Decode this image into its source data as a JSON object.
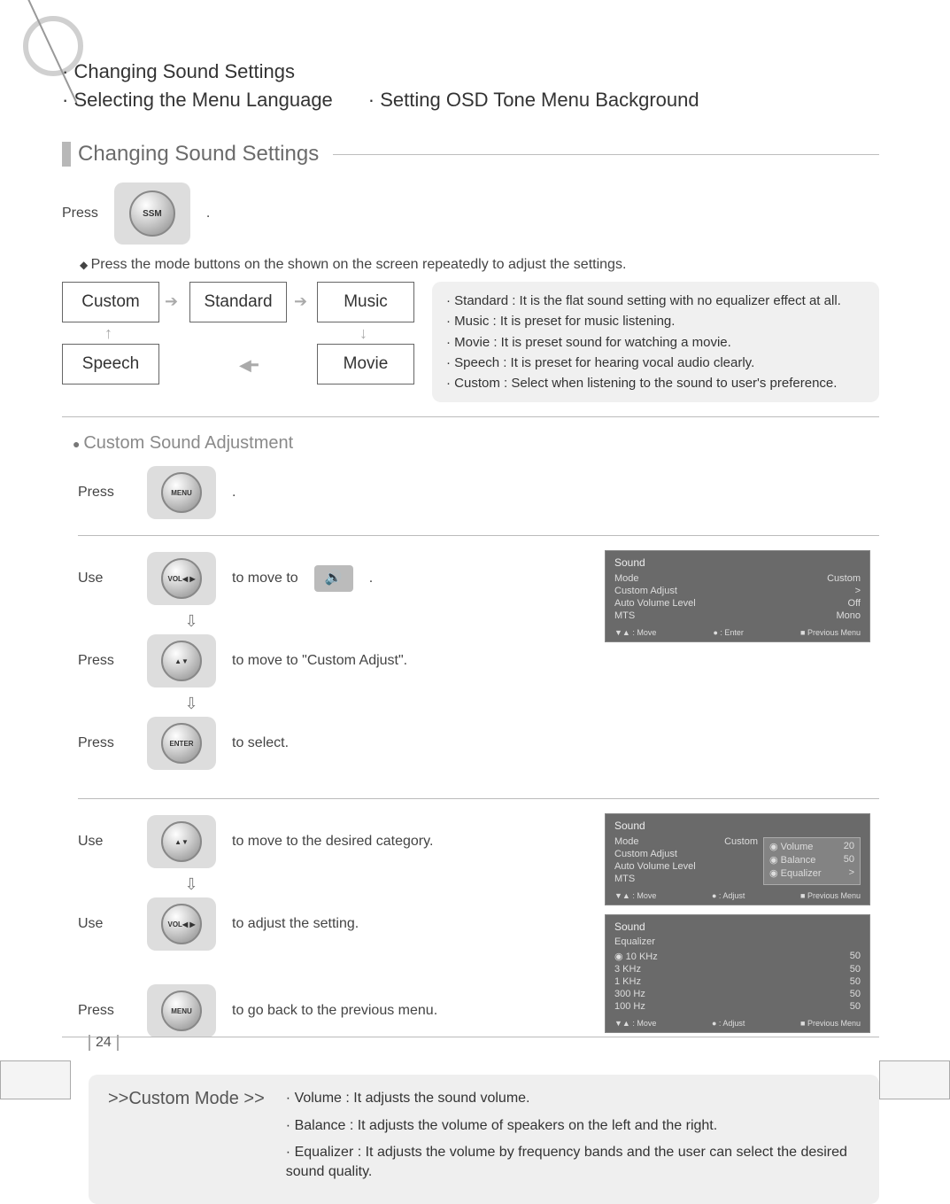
{
  "topics": {
    "a": "Changing Sound Settings",
    "b": "Selecting the Menu Language",
    "c": "Setting OSD Tone Menu Background"
  },
  "section_title": "Changing Sound Settings",
  "press_label": "Press",
  "use_label": "Use",
  "ssm_label": "SSM",
  "note_press_mode": "Press the mode buttons on the shown on the screen repeatedly to adjust the settings.",
  "modes": {
    "custom": "Custom",
    "standard": "Standard",
    "music": "Music",
    "speech": "Speech",
    "movie": "Movie"
  },
  "mode_desc": {
    "standard": "Standard : It is the flat sound setting with no equalizer effect at all.",
    "music": "Music : It is preset for music listening.",
    "movie": "Movie : It is preset sound for watching a movie.",
    "speech": "Speech : It is preset for hearing vocal audio clearly.",
    "custom": "Custom : Select when listening to the sound to user's preference."
  },
  "subsection_title": "Custom Sound Adjustment",
  "steps": {
    "s1_suffix": ".",
    "s2_prefix": "to move to",
    "s2_suffix": ".",
    "s3": "to move to \"Custom Adjust\".",
    "s4": "to select.",
    "s5": "to move to the desired category.",
    "s6": "to adjust the setting.",
    "s7": "to go back to the previous menu."
  },
  "btns": {
    "menu": "MENU",
    "vol": "VOL◀ ▶",
    "ch": "▲▼",
    "enter": "ENTER"
  },
  "osd1": {
    "title": "Sound",
    "rows": [
      {
        "k": "Mode",
        "v": "Custom"
      },
      {
        "k": "Custom Adjust",
        "v": ">"
      },
      {
        "k": "Auto Volume Level",
        "v": "Off"
      },
      {
        "k": "MTS",
        "v": "Mono"
      }
    ],
    "foot_l": "▼▲ : Move",
    "foot_m": "● : Enter",
    "foot_r": "■ Previous Menu"
  },
  "osd2": {
    "title": "Sound",
    "rows": [
      {
        "k": "Mode",
        "v": "Custom"
      },
      {
        "k": "Custom Adjust",
        "v": ""
      },
      {
        "k": "Auto Volume Level",
        "v": ""
      },
      {
        "k": "MTS",
        "v": ""
      }
    ],
    "submenu": [
      {
        "k": "◉ Volume",
        "v": "20"
      },
      {
        "k": "◉ Balance",
        "v": "50"
      },
      {
        "k": "◉ Equalizer",
        "v": ">"
      }
    ],
    "foot_l": "▼▲ : Move",
    "foot_m": "● : Adjust",
    "foot_r": "■ Previous Menu"
  },
  "osd3": {
    "title": "Sound",
    "sub": "Equalizer",
    "rows": [
      {
        "k": "◉ 10 KHz",
        "v": "50"
      },
      {
        "k": "3 KHz",
        "v": "50"
      },
      {
        "k": "1 KHz",
        "v": "50"
      },
      {
        "k": "300 Hz",
        "v": "50"
      },
      {
        "k": "100 Hz",
        "v": "50"
      }
    ],
    "foot_l": "▼▲ : Move",
    "foot_m": "● : Adjust",
    "foot_r": "■ Previous Menu"
  },
  "custom_mode": {
    "title": ">>Custom Mode >>",
    "volume": "Volume : It adjusts the sound volume.",
    "balance": "Balance : It adjusts the volume of speakers on the left and the right.",
    "equalizer": "Equalizer : It adjusts the volume by frequency bands and the user can select the desired sound quality."
  },
  "page_number": "24"
}
